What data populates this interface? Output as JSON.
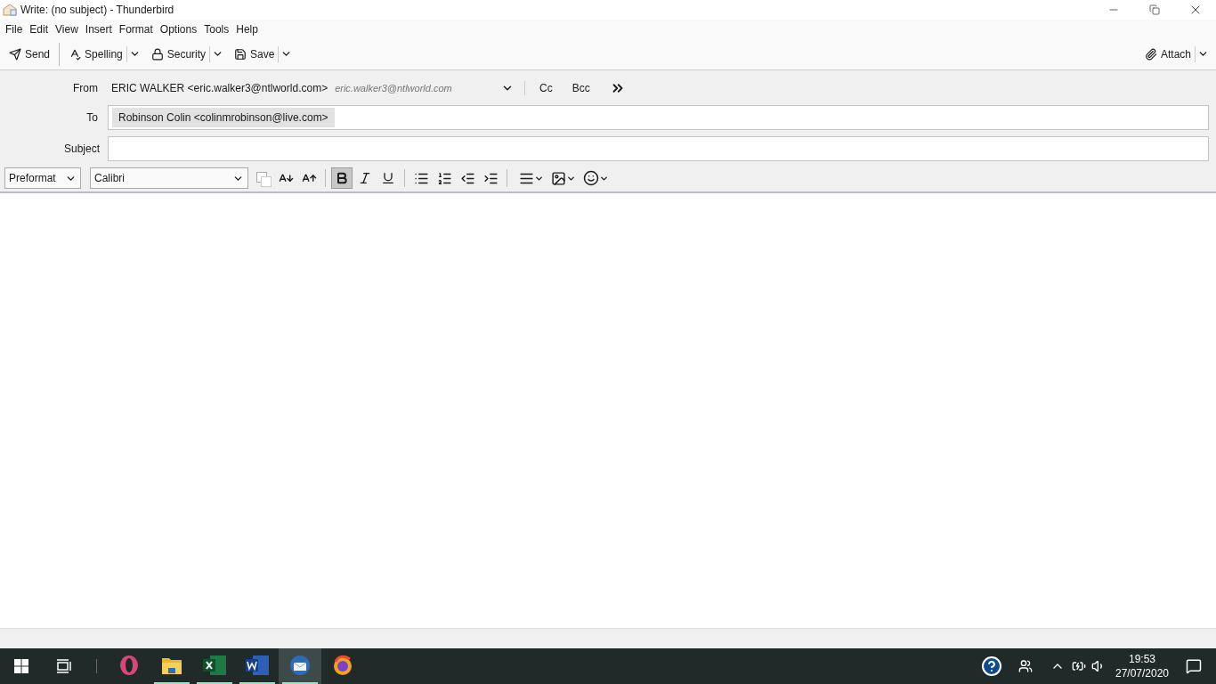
{
  "window": {
    "title": "Write: (no subject) - Thunderbird"
  },
  "menu": [
    "File",
    "Edit",
    "View",
    "Insert",
    "Format",
    "Options",
    "Tools",
    "Help"
  ],
  "toolbar": [
    {
      "kind": "send",
      "label": "Send",
      "dropdown": false
    },
    {
      "kind": "spelling",
      "label": "Spelling",
      "dropdown": true
    },
    {
      "kind": "security",
      "label": "Security",
      "dropdown": true
    },
    {
      "kind": "save",
      "label": "Save",
      "dropdown": true
    }
  ],
  "attach": {
    "label": "Attach"
  },
  "header": {
    "from_label": "From",
    "from_value": "ERIC WALKER <eric.walker3@ntlworld.com>",
    "from_hint": "eric.walker3@ntlworld.com",
    "cc": "Cc",
    "bcc": "Bcc",
    "to_label": "To",
    "recipients": [
      "Robinson Colin <colinmrobinson@live.com>"
    ],
    "subject_label": "Subject"
  },
  "format_bar": {
    "paragraph": "Preformat",
    "font": "Calibri",
    "buttons": [
      {
        "kind": "colors"
      },
      {
        "kind": "smaller"
      },
      {
        "kind": "larger"
      },
      {
        "kind": "sep"
      },
      {
        "kind": "bold",
        "pressed": true
      },
      {
        "kind": "italic",
        "pressed": false
      },
      {
        "kind": "underline",
        "pressed": false
      },
      {
        "kind": "sep"
      },
      {
        "kind": "bullets"
      },
      {
        "kind": "numbers"
      },
      {
        "kind": "outdent"
      },
      {
        "kind": "indent"
      },
      {
        "kind": "sep"
      },
      {
        "kind": "align"
      },
      {
        "kind": "image"
      },
      {
        "kind": "emoji"
      }
    ]
  },
  "taskbar": {
    "apps": [
      {
        "kind": "opera",
        "running": false,
        "selected": false
      },
      {
        "kind": "explorer",
        "running": true,
        "selected": false
      },
      {
        "kind": "excel",
        "running": true,
        "selected": false
      },
      {
        "kind": "word",
        "running": true,
        "selected": false
      },
      {
        "kind": "thunderbird",
        "running": true,
        "selected": true
      },
      {
        "kind": "firefox",
        "running": false,
        "selected": false
      }
    ],
    "time": "19:53",
    "date": "27/07/2020"
  }
}
